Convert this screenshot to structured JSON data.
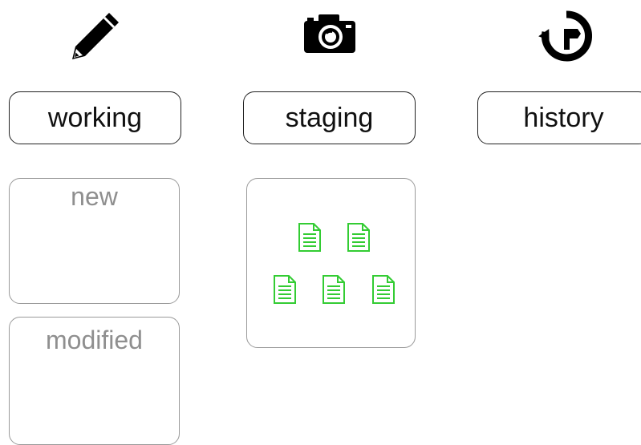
{
  "icons": {
    "working": "pencil-icon",
    "staging": "camera-icon",
    "history": "history-icon"
  },
  "areas": {
    "working": {
      "label": "working"
    },
    "staging": {
      "label": "staging"
    },
    "history": {
      "label": "history"
    }
  },
  "boxes": {
    "new": {
      "title": "new"
    },
    "modified": {
      "title": "modified"
    },
    "staging": {
      "file_count": 5,
      "file_icon": "document-icon"
    }
  },
  "colors": {
    "file_icon": "#33cc33",
    "box_border": "#9a9a9a",
    "box_title": "#8f8f8f",
    "label_border": "#222222"
  }
}
